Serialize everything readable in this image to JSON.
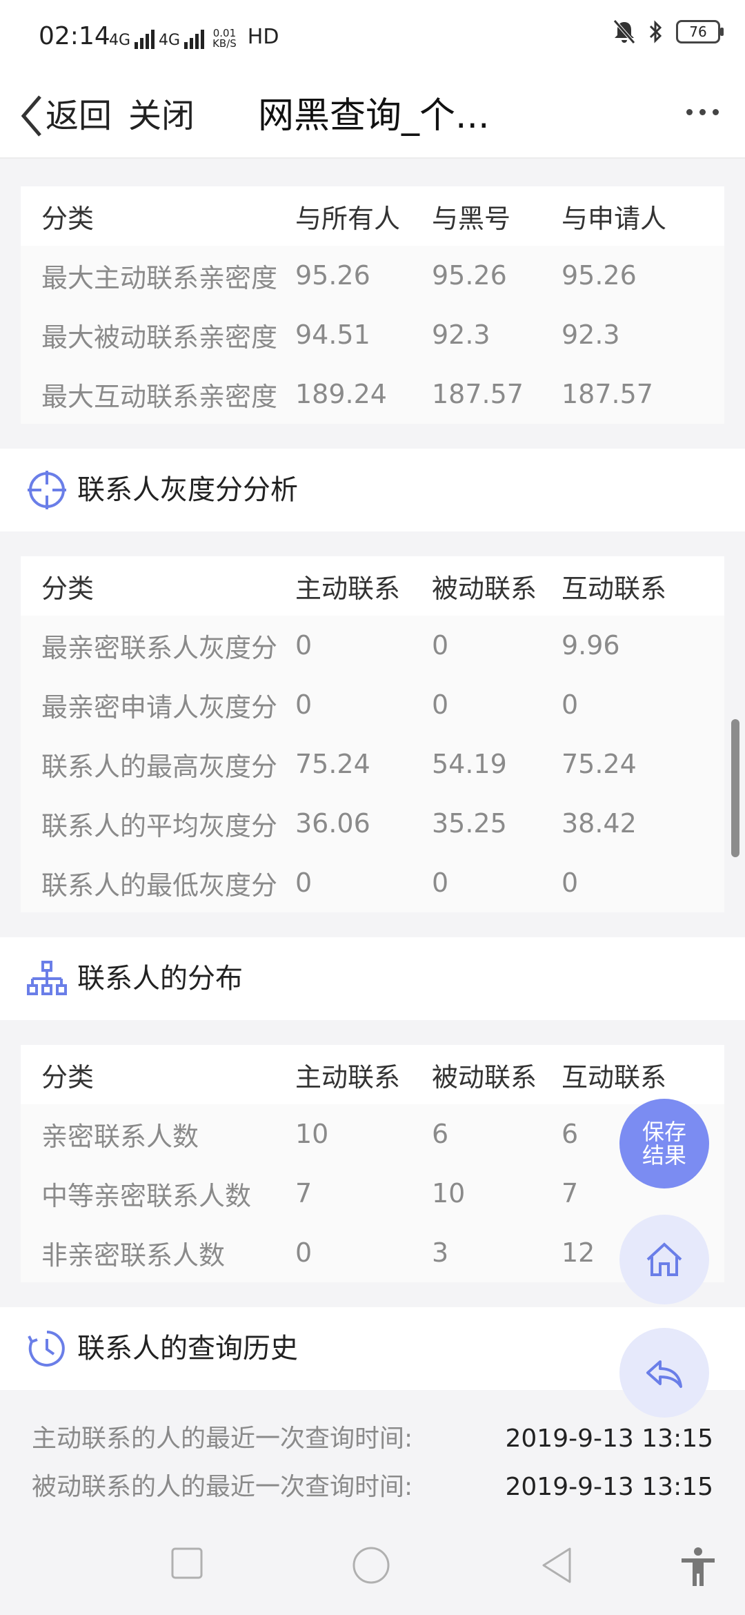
{
  "status_bar": {
    "time": "02:14",
    "signal1": "4G",
    "signal2": "4G",
    "speed_value": "0.01",
    "speed_unit": "KB/S",
    "hd": "HD",
    "battery": "76"
  },
  "nav": {
    "back_label": "返回",
    "close_label": "关闭",
    "title": "网黑查询_个..."
  },
  "table1": {
    "headers": [
      "分类",
      "与所有人",
      "与黑号",
      "与申请人"
    ],
    "rows": [
      [
        "最大主动联系亲密度",
        "95.26",
        "95.26",
        "95.26"
      ],
      [
        "最大被动联系亲密度",
        "94.51",
        "92.3",
        "92.3"
      ],
      [
        "最大互动联系亲密度",
        "189.24",
        "187.57",
        "187.57"
      ]
    ]
  },
  "section_gray": {
    "title": "联系人灰度分分析"
  },
  "table2": {
    "headers": [
      "分类",
      "主动联系",
      "被动联系",
      "互动联系"
    ],
    "rows": [
      [
        "最亲密联系人灰度分",
        "0",
        "0",
        "9.96"
      ],
      [
        "最亲密申请人灰度分",
        "0",
        "0",
        "0"
      ],
      [
        "联系人的最高灰度分",
        "75.24",
        "54.19",
        "75.24"
      ],
      [
        "联系人的平均灰度分",
        "36.06",
        "35.25",
        "38.42"
      ],
      [
        "联系人的最低灰度分",
        "0",
        "0",
        "0"
      ]
    ]
  },
  "section_dist": {
    "title": "联系人的分布"
  },
  "table3": {
    "headers": [
      "分类",
      "主动联系",
      "被动联系",
      "互动联系"
    ],
    "rows": [
      [
        "亲密联系人数",
        "10",
        "6",
        "6"
      ],
      [
        "中等亲密联系人数",
        "7",
        "10",
        "7"
      ],
      [
        "非亲密联系人数",
        "0",
        "3",
        "12"
      ]
    ]
  },
  "section_history": {
    "title": "联系人的查询历史"
  },
  "history": [
    {
      "label": "主动联系的人的最近一次查询时间:",
      "value": "2019-9-13 13:15"
    },
    {
      "label": "被动联系的人的最近一次查询时间:",
      "value": "2019-9-13 13:15"
    }
  ],
  "fab": {
    "save_line1": "保存",
    "save_line2": "结果"
  },
  "colors": {
    "accent": "#7b8cf2",
    "icon_blue": "#6a7ee8"
  }
}
